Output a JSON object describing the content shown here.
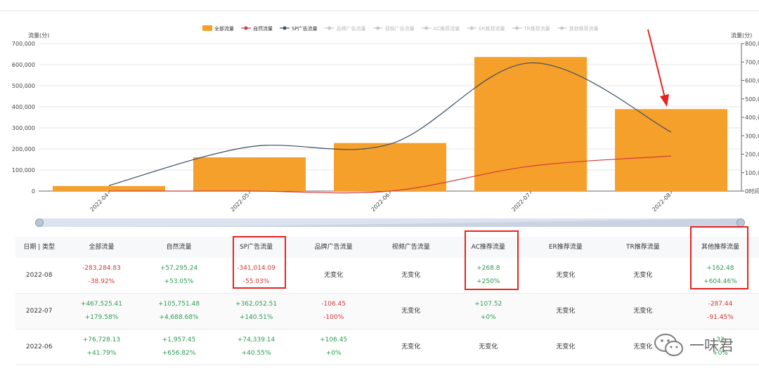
{
  "chart_data": {
    "type": "bar",
    "categories": [
      "2022-04",
      "2022-05",
      "2022-06",
      "2022-07",
      "2022-08"
    ],
    "legend": [
      {
        "name": "全部流量",
        "kind": "bar",
        "color": "#f5a02a",
        "active": true
      },
      {
        "name": "自然流量",
        "kind": "line",
        "color": "#cf3b3b",
        "active": true
      },
      {
        "name": "SP广告流量",
        "kind": "line",
        "color": "#3b4e63",
        "active": true
      },
      {
        "name": "品牌广告流量",
        "kind": "line",
        "color": "#c8c8c8",
        "active": false
      },
      {
        "name": "视频广告流量",
        "kind": "line",
        "color": "#c8c8c8",
        "active": false
      },
      {
        "name": "AC推荐流量",
        "kind": "line",
        "color": "#c8c8c8",
        "active": false
      },
      {
        "name": "ER推荐流量",
        "kind": "line",
        "color": "#c8c8c8",
        "active": false
      },
      {
        "name": "TR推荐流量",
        "kind": "line",
        "color": "#c8c8c8",
        "active": false
      },
      {
        "name": "其他推荐流量",
        "kind": "line",
        "color": "#c8c8c8",
        "active": false
      }
    ],
    "series": [
      {
        "name": "全部流量",
        "axis": "left",
        "values": [
          24000,
          160000,
          228000,
          636000,
          389000
        ]
      },
      {
        "name": "自然流量",
        "axis": "right",
        "values": [
          0,
          0,
          0,
          135000,
          190000
        ]
      },
      {
        "name": "SP广告流量",
        "axis": "right",
        "values": [
          30000,
          240000,
          255000,
          695000,
          320000
        ]
      }
    ],
    "left_axis": {
      "label": "流量(分)",
      "ylim": [
        0,
        700000
      ],
      "ticks": [
        "0",
        "100,000",
        "200,000",
        "300,000",
        "400,000",
        "500,000",
        "600,000",
        "700,000"
      ]
    },
    "right_axis": {
      "label": "流量(分)",
      "ylim": [
        0,
        800000
      ],
      "ticks": [
        "0时间",
        "100,000",
        "200,000",
        "300,000",
        "400,000",
        "500,000",
        "600,000",
        "700,000",
        "800,000"
      ]
    },
    "grid": true,
    "legend_position": "top-center"
  },
  "table": {
    "headers": [
      "日期 | 类型",
      "全部流量",
      "自然流量",
      "SP广告流量",
      "品牌广告流量",
      "视频广告流量",
      "AC推荐流量",
      "ER推荐流量",
      "TR推荐流量",
      "其他推荐流量"
    ],
    "rows": [
      {
        "date": "2022-08",
        "cells": [
          {
            "v": "-283,284.83",
            "p": "-38.92%",
            "t": "down"
          },
          {
            "v": "+57,295.24",
            "p": "+53.05%",
            "t": "up"
          },
          {
            "v": "-341,014.09",
            "p": "-55.03%",
            "t": "down"
          },
          {
            "v": "无变化",
            "p": "",
            "t": "flat"
          },
          {
            "v": "无变化",
            "p": "",
            "t": "flat"
          },
          {
            "v": "+268.8",
            "p": "+250%",
            "t": "up"
          },
          {
            "v": "无变化",
            "p": "",
            "t": "flat"
          },
          {
            "v": "无变化",
            "p": "",
            "t": "flat"
          },
          {
            "v": "+162.48",
            "p": "+604.46%",
            "t": "up"
          }
        ]
      },
      {
        "date": "2022-07",
        "cells": [
          {
            "v": "+467,525.41",
            "p": "+179.58%",
            "t": "up"
          },
          {
            "v": "+105,751.48",
            "p": "+4,688.68%",
            "t": "up"
          },
          {
            "v": "+362,052.51",
            "p": "+140.51%",
            "t": "up"
          },
          {
            "v": "-106.45",
            "p": "-100%",
            "t": "down"
          },
          {
            "v": "无变化",
            "p": "",
            "t": "flat"
          },
          {
            "v": "+107.52",
            "p": "+0%",
            "t": "up"
          },
          {
            "v": "无变化",
            "p": "",
            "t": "flat"
          },
          {
            "v": "无变化",
            "p": "",
            "t": "flat"
          },
          {
            "v": "-287.44",
            "p": "-91.45%",
            "t": "down"
          }
        ]
      },
      {
        "date": "2022-06",
        "cells": [
          {
            "v": "+76,728.13",
            "p": "+41.79%",
            "t": "up"
          },
          {
            "v": "+1,957.45",
            "p": "+656.82%",
            "t": "up"
          },
          {
            "v": "+74,339.14",
            "p": "+40.55%",
            "t": "up"
          },
          {
            "v": "+106.45",
            "p": "+0%",
            "t": "up"
          },
          {
            "v": "无变化",
            "p": "",
            "t": "flat"
          },
          {
            "v": "无变化",
            "p": "",
            "t": "flat"
          },
          {
            "v": "无变化",
            "p": "",
            "t": "flat"
          },
          {
            "v": "无变化",
            "p": "",
            "t": "flat"
          },
          {
            "v": "32",
            "p": "+0%",
            "t": "up"
          }
        ]
      }
    ]
  },
  "watermark": {
    "text": "一味君",
    "icon": "wechat-icon"
  },
  "colors": {
    "bar": "#f5a02a",
    "natural": "#cf3b3b",
    "sp": "#3b4e63",
    "highlight": "#e8231f",
    "up": "#2e9a53",
    "down": "#cf3b3b"
  }
}
